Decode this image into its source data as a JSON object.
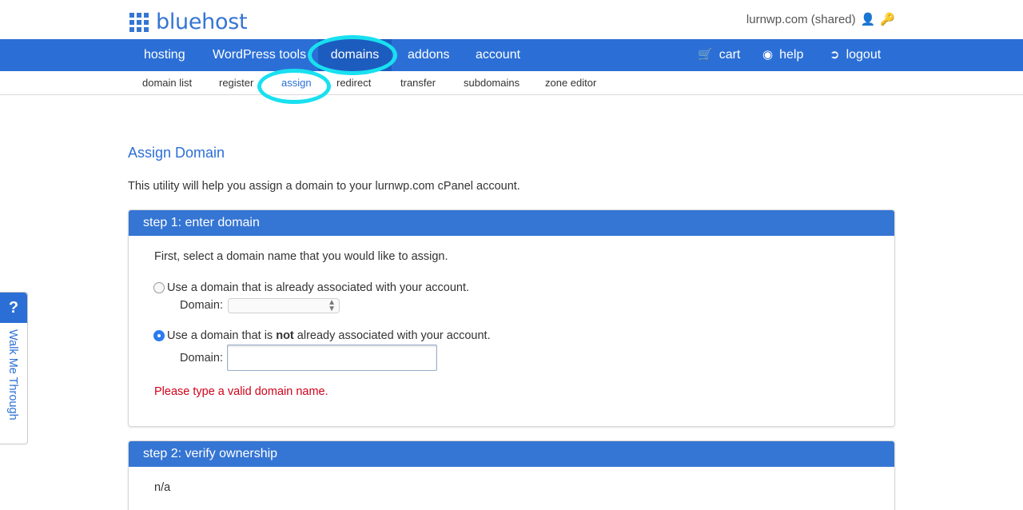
{
  "brand": {
    "name": "bluehost"
  },
  "account": {
    "label": "lurnwp.com (shared)"
  },
  "main_nav": {
    "items": [
      {
        "label": "hosting"
      },
      {
        "label": "WordPress tools"
      },
      {
        "label": "domains"
      },
      {
        "label": "addons"
      },
      {
        "label": "account"
      }
    ],
    "right": [
      {
        "label": "cart",
        "icon": "cart-icon"
      },
      {
        "label": "help",
        "icon": "lifebuoy-icon"
      },
      {
        "label": "logout",
        "icon": "logout-icon"
      }
    ]
  },
  "sub_nav": {
    "items": [
      {
        "label": "domain list"
      },
      {
        "label": "register"
      },
      {
        "label": "assign"
      },
      {
        "label": "redirect"
      },
      {
        "label": "transfer"
      },
      {
        "label": "subdomains"
      },
      {
        "label": "zone editor"
      }
    ]
  },
  "page": {
    "title": "Assign Domain",
    "intro": "This utility will help you assign a domain to your lurnwp.com cPanel account."
  },
  "step1": {
    "header": "step 1: enter domain",
    "lead": "First, select a domain name that you would like to assign.",
    "option_existing": "Use a domain that is already associated with your account.",
    "option_new_prefix": "Use a domain that is ",
    "option_new_bold": "not",
    "option_new_suffix": " already associated with your account.",
    "domain_label": "Domain:",
    "domain_select_value": "",
    "domain_input_value": "",
    "error": "Please type a valid domain name."
  },
  "step2": {
    "header": "step 2: verify ownership",
    "body": "n/a"
  },
  "walkme": {
    "icon_label": "?",
    "label": "Walk Me Through"
  },
  "colors": {
    "brand_blue": "#3575d3",
    "nav_blue": "#2b6fd6",
    "highlight_cyan": "#19e0f0",
    "error_red": "#d0021b"
  }
}
